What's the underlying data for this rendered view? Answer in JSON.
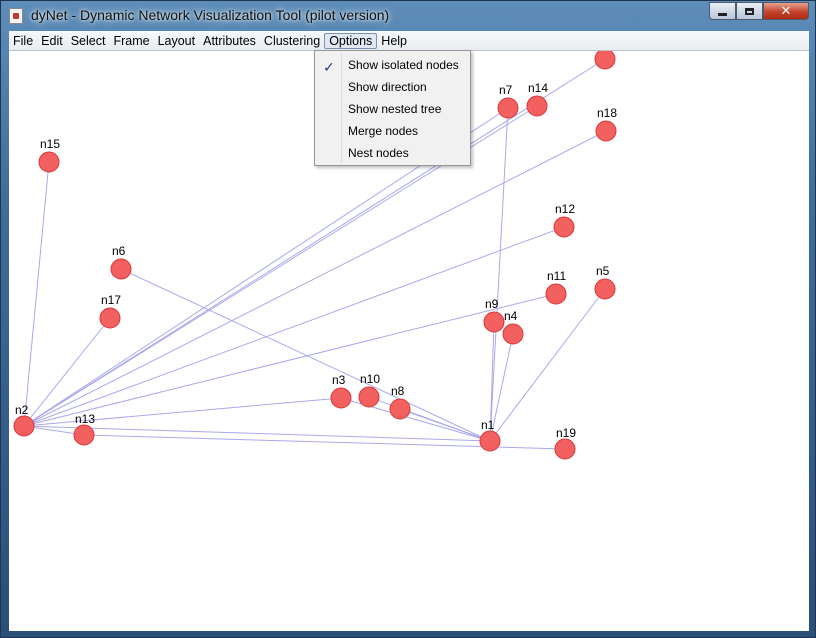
{
  "window": {
    "title": "dyNet - Dynamic Network Visualization Tool (pilot version)",
    "close_glyph": "✕"
  },
  "menubar": {
    "items": [
      {
        "label": "File"
      },
      {
        "label": "Edit"
      },
      {
        "label": "Select"
      },
      {
        "label": "Frame"
      },
      {
        "label": "Layout"
      },
      {
        "label": "Attributes"
      },
      {
        "label": "Clustering"
      },
      {
        "label": "Options"
      },
      {
        "label": "Help"
      }
    ],
    "active_index": 7
  },
  "options_menu": {
    "items": [
      {
        "label": "Show isolated nodes",
        "checked": true
      },
      {
        "label": "Show direction",
        "checked": false
      },
      {
        "label": "Show nested tree",
        "checked": false
      },
      {
        "label": "Merge nodes",
        "checked": false
      },
      {
        "label": "Nest nodes",
        "checked": false
      }
    ],
    "check_glyph": "✓"
  },
  "graph": {
    "node_color": "#f26060",
    "node_stroke": "#d83838",
    "edge_color": "#a9a9ee",
    "nodes": [
      {
        "id": "n1",
        "label": "n1"
      },
      {
        "id": "n2",
        "label": "n2"
      },
      {
        "id": "n3",
        "label": "n3"
      },
      {
        "id": "n4",
        "label": "n4"
      },
      {
        "id": "n5",
        "label": "n5"
      },
      {
        "id": "n6",
        "label": "n6"
      },
      {
        "id": "n7",
        "label": "n7"
      },
      {
        "id": "n8",
        "label": "n8"
      },
      {
        "id": "n9",
        "label": "n9"
      },
      {
        "id": "n10",
        "label": "n10"
      },
      {
        "id": "n11",
        "label": "n11"
      },
      {
        "id": "n12",
        "label": "n12"
      },
      {
        "id": "n13",
        "label": "n13"
      },
      {
        "id": "n14",
        "label": "n14"
      },
      {
        "id": "n15",
        "label": "n15"
      },
      {
        "id": "n16",
        "label": ""
      },
      {
        "id": "n17",
        "label": "n17"
      },
      {
        "id": "n18",
        "label": "n18"
      },
      {
        "id": "n19",
        "label": "n19"
      }
    ],
    "edges": [
      [
        "n2",
        "n15"
      ],
      [
        "n2",
        "n17"
      ],
      [
        "n2",
        "n13"
      ],
      [
        "n2",
        "n1"
      ],
      [
        "n2",
        "n3"
      ],
      [
        "n2",
        "n12"
      ],
      [
        "n2",
        "n11"
      ],
      [
        "n2",
        "n18"
      ],
      [
        "n2",
        "n7"
      ],
      [
        "n2",
        "n14"
      ],
      [
        "n2",
        "n16"
      ],
      [
        "n6",
        "n1"
      ],
      [
        "n3",
        "n1"
      ],
      [
        "n10",
        "n1"
      ],
      [
        "n8",
        "n1"
      ],
      [
        "n9",
        "n1"
      ],
      [
        "n7",
        "n1"
      ],
      [
        "n4",
        "n1"
      ],
      [
        "n5",
        "n1"
      ],
      [
        "n13",
        "n19"
      ]
    ]
  }
}
